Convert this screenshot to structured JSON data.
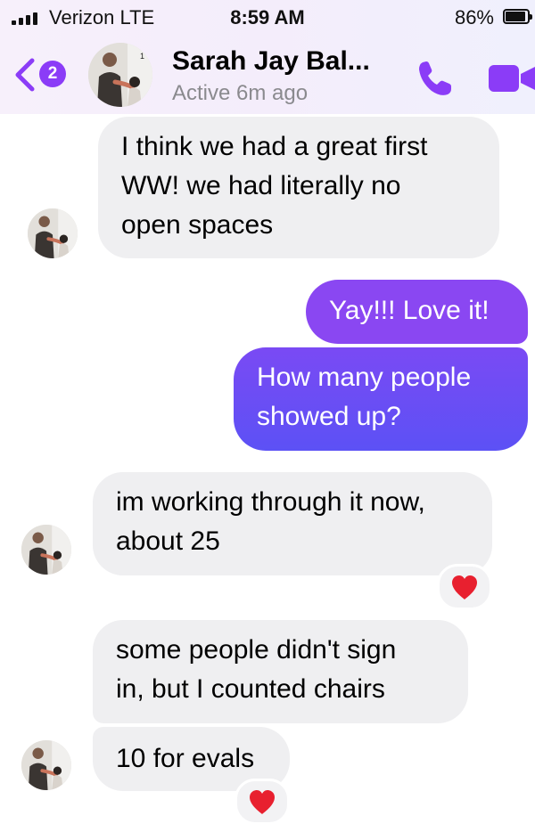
{
  "status_bar": {
    "carrier": "Verizon  LTE",
    "time": "8:59 AM",
    "battery": "86%"
  },
  "header": {
    "back_badge": "2",
    "contact_name": "Sarah Jay Bal...",
    "status": "Active 6m ago"
  },
  "messages": [
    {
      "sender": "contact",
      "lines": [
        "I think we had a great first",
        "WW! we had literally no",
        "open spaces"
      ]
    },
    {
      "sender": "me",
      "lines": [
        "Yay!!! Love it!"
      ]
    },
    {
      "sender": "me",
      "lines": [
        "How many people",
        "showed up?"
      ]
    },
    {
      "sender": "contact",
      "lines": [
        "im working through it now,",
        "about 25"
      ],
      "reaction": "heart"
    },
    {
      "sender": "contact",
      "lines": [
        "some people didn't sign",
        "in, but I counted chairs"
      ]
    },
    {
      "sender": "contact",
      "lines": [
        "10 for evals"
      ],
      "reaction": "heart"
    }
  ],
  "colors": {
    "accent": "#8b3cf7",
    "outgoing_top": "#8e46f0",
    "outgoing_bottom": "#5b50f5",
    "incoming": "#efeff1",
    "reaction_heart": "#e8202f"
  },
  "icons": {
    "back": "chevron-left-icon",
    "call": "phone-icon",
    "video": "video-camera-icon",
    "reaction": "heart-icon"
  }
}
